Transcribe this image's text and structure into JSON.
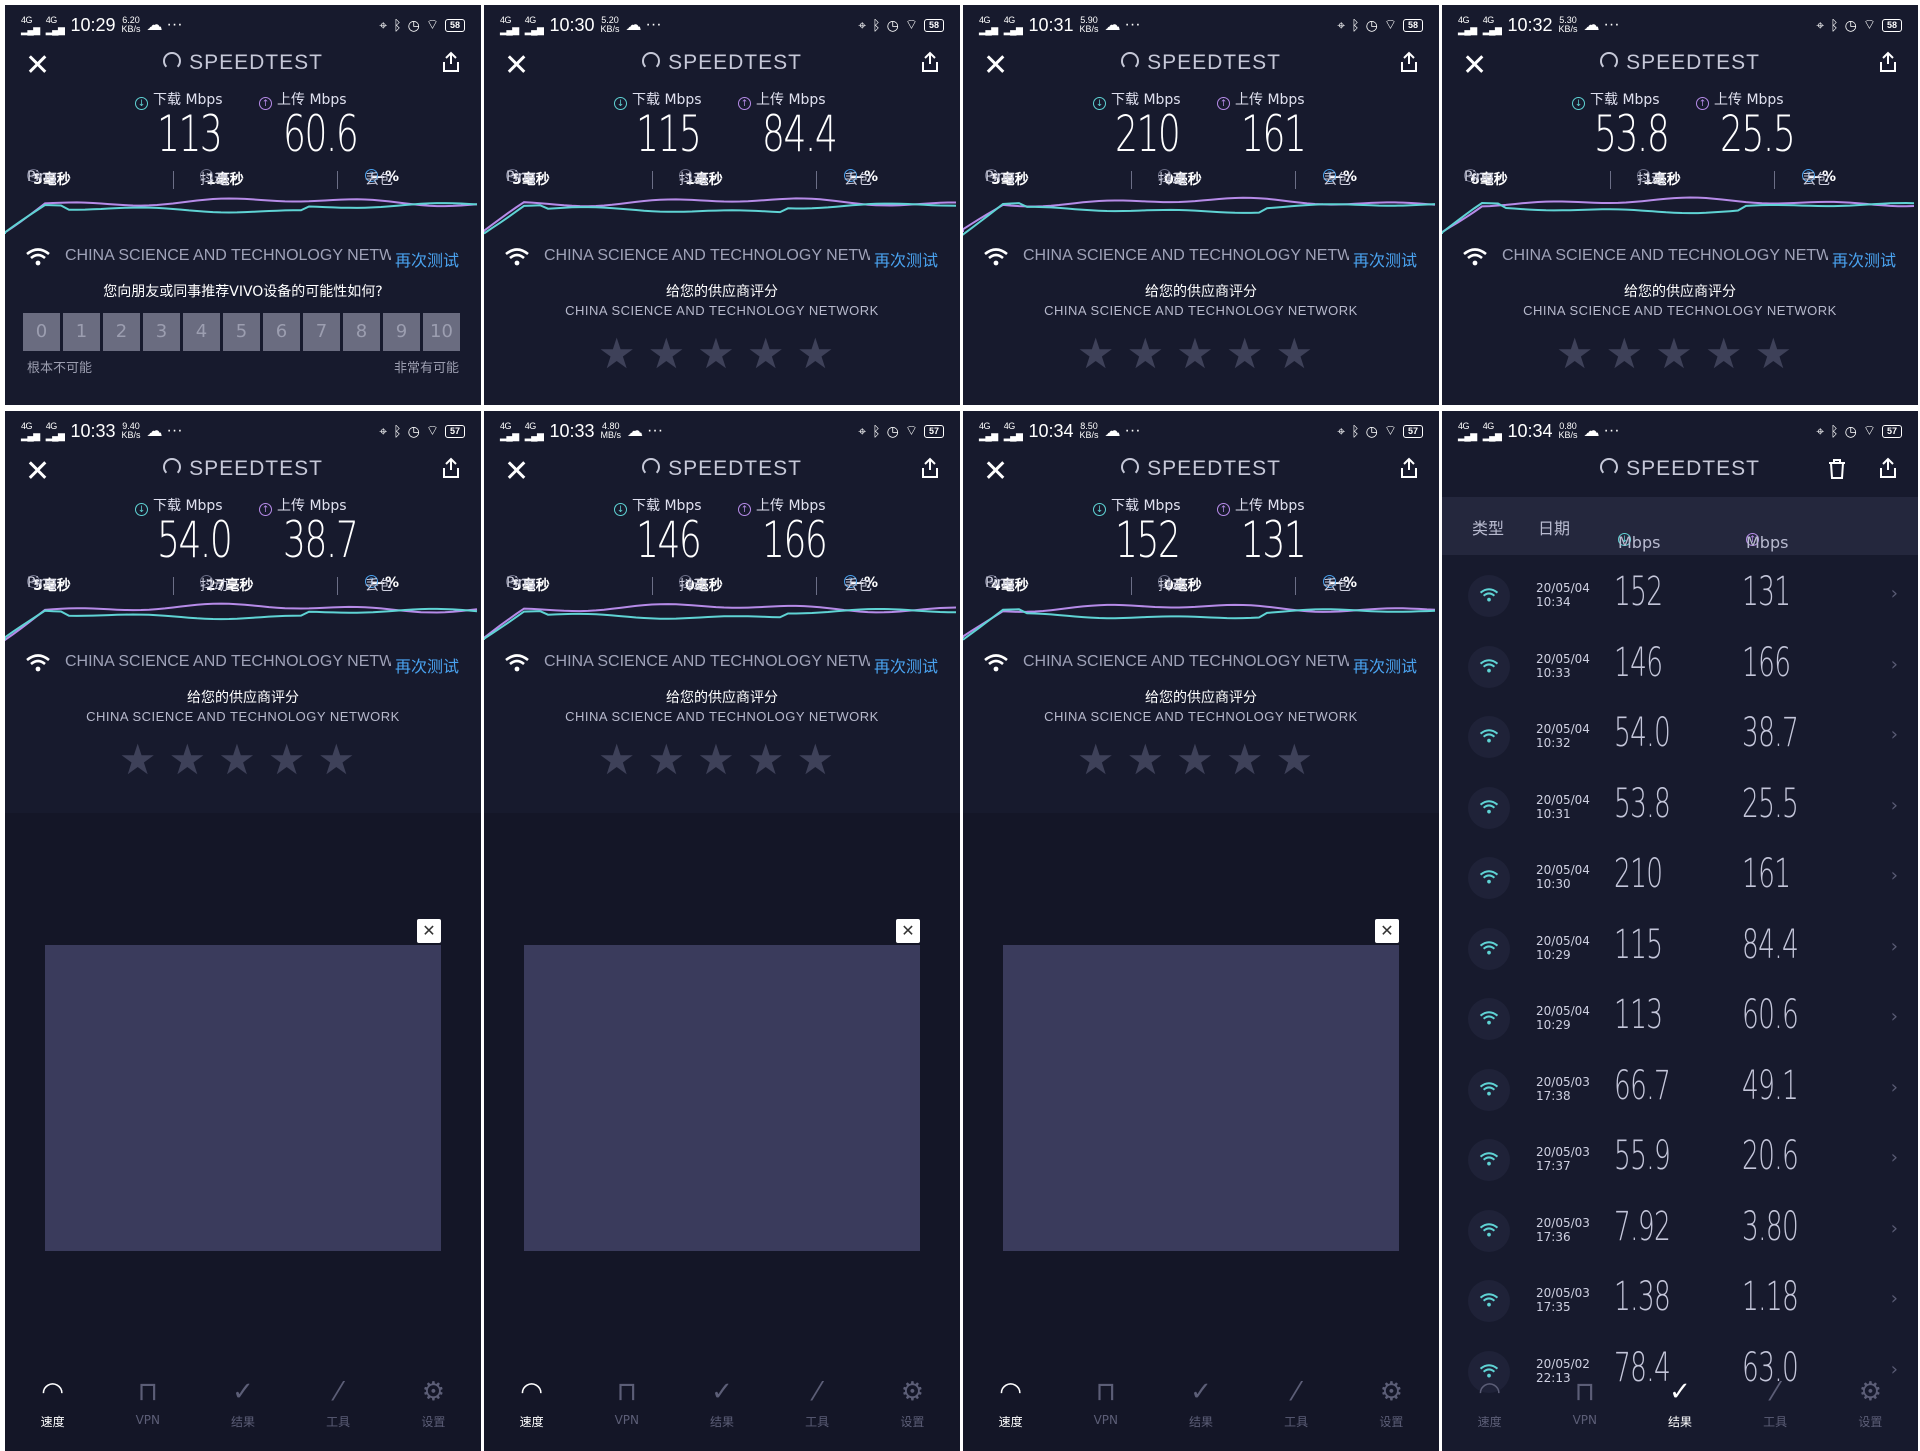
{
  "app": {
    "title": "SPEEDTEST",
    "labels": {
      "download": "下载 Mbps",
      "upload": "上传 Mbps",
      "ping": "Ping",
      "jitter": "抖动",
      "loss": "丢包",
      "loss_value": "—%",
      "isp": "CHINA SCIENCE AND TECHNOLOGY NETWORK",
      "retest": "再次测试",
      "rate_title": "给您的供应商评分",
      "rate_isp": "CHINA SCIENCE AND TECHNOLOGY NETWORK",
      "nps_question": "您向朋友或同事推荐VIVO设备的可能性如何?",
      "nps_low": "根本不可能",
      "nps_high": "非常有可能"
    },
    "nav": [
      "速度",
      "VPN",
      "结果",
      "工具",
      "设置"
    ],
    "icons": {
      "close": "close-icon",
      "share": "share-icon",
      "delete": "trash-icon",
      "wifi": "wifi-icon",
      "star": "star-icon"
    },
    "colors": {
      "background": "#171a2d",
      "download": "#5fd3d4",
      "upload": "#b68be8",
      "link": "#4aa3f0"
    }
  },
  "results": [
    {
      "time": "10:29",
      "speed": "6.20",
      "speed_unit": "KB/s",
      "battery": "58",
      "download": "113",
      "upload": "60.6",
      "ping": "5毫秒",
      "jitter": "1毫秒",
      "nps": true,
      "stars": "★★★★★"
    },
    {
      "time": "10:30",
      "speed": "5.20",
      "speed_unit": "KB/s",
      "battery": "58",
      "download": "115",
      "upload": "84.4",
      "ping": "5毫秒",
      "jitter": "1毫秒",
      "stars": "★★★★★"
    },
    {
      "time": "10:31",
      "speed": "5.90",
      "speed_unit": "KB/s",
      "battery": "58",
      "download": "210",
      "upload": "161",
      "ping": "5毫秒",
      "jitter": "0毫秒",
      "stars": "★★★★★"
    },
    {
      "time": "10:32",
      "speed": "5.30",
      "speed_unit": "KB/s",
      "battery": "58",
      "download": "53.8",
      "upload": "25.5",
      "ping": "6毫秒",
      "jitter": "1毫秒",
      "stars": "★★★★★"
    },
    {
      "time": "10:33",
      "speed": "9.40",
      "speed_unit": "KB/s",
      "battery": "57",
      "download": "54.0",
      "upload": "38.7",
      "ping": "5毫秒",
      "jitter": "27毫秒",
      "stars": "★★★★★"
    },
    {
      "time": "10:33",
      "speed": "4.80",
      "speed_unit": "MB/s",
      "battery": "57",
      "download": "146",
      "upload": "166",
      "ping": "5毫秒",
      "jitter": "0毫秒",
      "stars": "★★★★★"
    },
    {
      "time": "10:34",
      "speed": "8.50",
      "speed_unit": "KB/s",
      "battery": "57",
      "download": "152",
      "upload": "131",
      "ping": "4毫秒",
      "jitter": "0毫秒",
      "stars": "★★★★★"
    }
  ],
  "history": {
    "status": {
      "time": "10:34",
      "speed": "0.80",
      "speed_unit": "KB/s",
      "battery": "57"
    },
    "columns": {
      "type": "类型",
      "date": "日期",
      "down": "Mbps",
      "up": "Mbps"
    },
    "rows": [
      {
        "date": "20/05/04",
        "time": "10:34",
        "down": "152",
        "up": "131"
      },
      {
        "date": "20/05/04",
        "time": "10:33",
        "down": "146",
        "up": "166"
      },
      {
        "date": "20/05/04",
        "time": "10:32",
        "down": "54.0",
        "up": "38.7"
      },
      {
        "date": "20/05/04",
        "time": "10:31",
        "down": "53.8",
        "up": "25.5"
      },
      {
        "date": "20/05/04",
        "time": "10:30",
        "down": "210",
        "up": "161"
      },
      {
        "date": "20/05/04",
        "time": "10:29",
        "down": "115",
        "up": "84.4"
      },
      {
        "date": "20/05/04",
        "time": "10:29",
        "down": "113",
        "up": "60.6"
      },
      {
        "date": "20/05/03",
        "time": "17:38",
        "down": "66.7",
        "up": "49.1"
      },
      {
        "date": "20/05/03",
        "time": "17:37",
        "down": "55.9",
        "up": "20.6"
      },
      {
        "date": "20/05/03",
        "time": "17:36",
        "down": "7.92",
        "up": "3.80"
      },
      {
        "date": "20/05/03",
        "time": "17:35",
        "down": "1.38",
        "up": "1.18"
      },
      {
        "date": "20/05/02",
        "time": "22:13",
        "down": "78.4",
        "up": "63.0"
      }
    ]
  }
}
